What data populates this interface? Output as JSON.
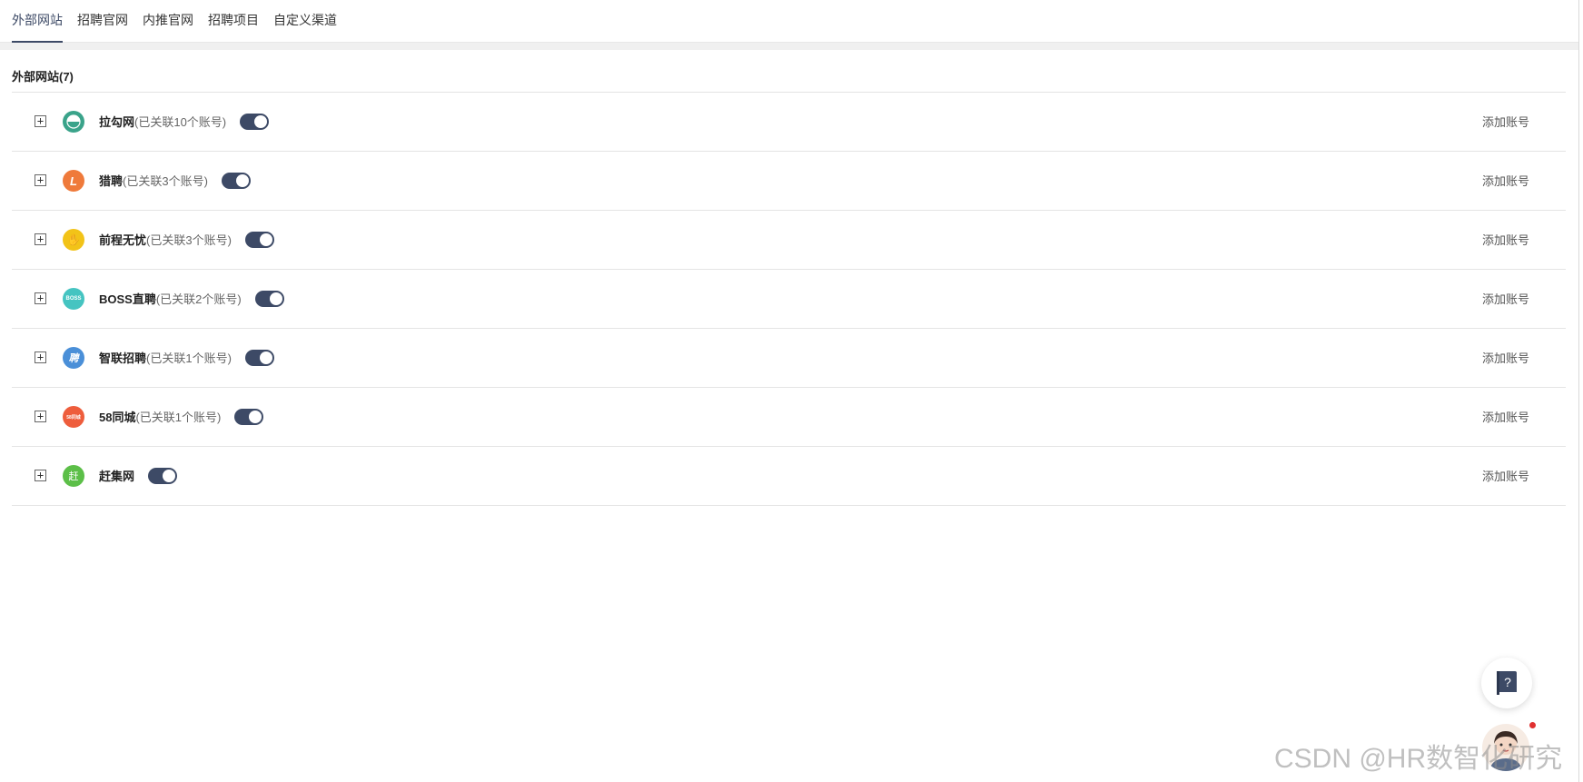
{
  "tabs": [
    {
      "label": "外部网站",
      "active": true
    },
    {
      "label": "招聘官网",
      "active": false
    },
    {
      "label": "内推官网",
      "active": false
    },
    {
      "label": "招聘项目",
      "active": false
    },
    {
      "label": "自定义渠道",
      "active": false
    }
  ],
  "section_title": "外部网站(7)",
  "add_account_label": "添加账号",
  "accent_color": "#3d4a66",
  "channels": [
    {
      "name": "拉勾网",
      "count": "(已关联10个账号)",
      "logo": "lagou-logo",
      "logo_color": "#3aa38a",
      "logo_text": "",
      "enabled": true
    },
    {
      "name": "猎聘",
      "count": "(已关联3个账号)",
      "logo": "liepin-logo",
      "logo_color": "#ef7a3b",
      "logo_text": "L",
      "enabled": true
    },
    {
      "name": "前程无忧",
      "count": "(已关联3个账号)",
      "logo": "51job-logo",
      "logo_color": "#f2c318",
      "logo_text": "✋",
      "enabled": true
    },
    {
      "name": "BOSS直聘",
      "count": "(已关联2个账号)",
      "logo": "boss-logo",
      "logo_color": "#45c4c1",
      "logo_text": "BOSS",
      "enabled": true
    },
    {
      "name": "智联招聘",
      "count": "(已关联1个账号)",
      "logo": "zhaopin-logo",
      "logo_color": "#4a8fd8",
      "logo_text": "聘",
      "enabled": true
    },
    {
      "name": "58同城",
      "count": "(已关联1个账号)",
      "logo": "58-logo",
      "logo_color": "#ee5d3c",
      "logo_text": "58同城",
      "enabled": true
    },
    {
      "name": "赶集网",
      "count": "",
      "logo": "ganji-logo",
      "logo_color": "#5cbf48",
      "logo_text": "赶",
      "enabled": true
    }
  ],
  "watermark": "CSDN @HR数智化研究"
}
